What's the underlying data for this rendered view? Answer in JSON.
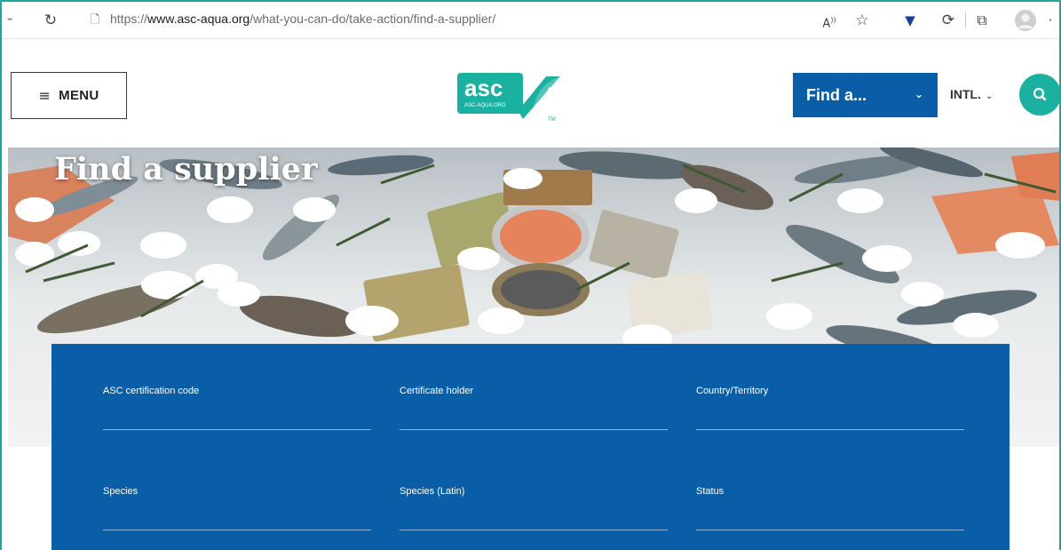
{
  "browser": {
    "url_prefix": "https://",
    "url_host": "www.asc-aqua.org",
    "url_path": "/what-you-can-do/take-action/find-a-supplier/",
    "icons": [
      "back-icon",
      "reload-icon",
      "site-info-icon",
      "read-aloud-icon",
      "favorites-icon",
      "extension-shield-icon",
      "extension-c-icon",
      "collections-icon",
      "profile-icon",
      "more-icon"
    ]
  },
  "header": {
    "menu_label": "MENU",
    "logo_text": "asc",
    "logo_subtext": "ASC-AQUA.ORG",
    "logo_tm": "TM",
    "find_label": "Find a...",
    "region_label": "INTL.",
    "icons": [
      "hamburger-icon",
      "chevron-down-icon",
      "search-icon"
    ]
  },
  "hero": {
    "title": "Find a supplier"
  },
  "form": {
    "fields": [
      {
        "label": "ASC certification code",
        "value": ""
      },
      {
        "label": "Certificate holder",
        "value": ""
      },
      {
        "label": "Country/Territory",
        "value": ""
      },
      {
        "label": "Species",
        "value": ""
      },
      {
        "label": "Species (Latin)",
        "value": ""
      },
      {
        "label": "Status",
        "value": ""
      }
    ]
  },
  "colors": {
    "brand_teal": "#1bb1a0",
    "brand_blue": "#0a5ea8",
    "frame_border": "#1aa89a"
  }
}
